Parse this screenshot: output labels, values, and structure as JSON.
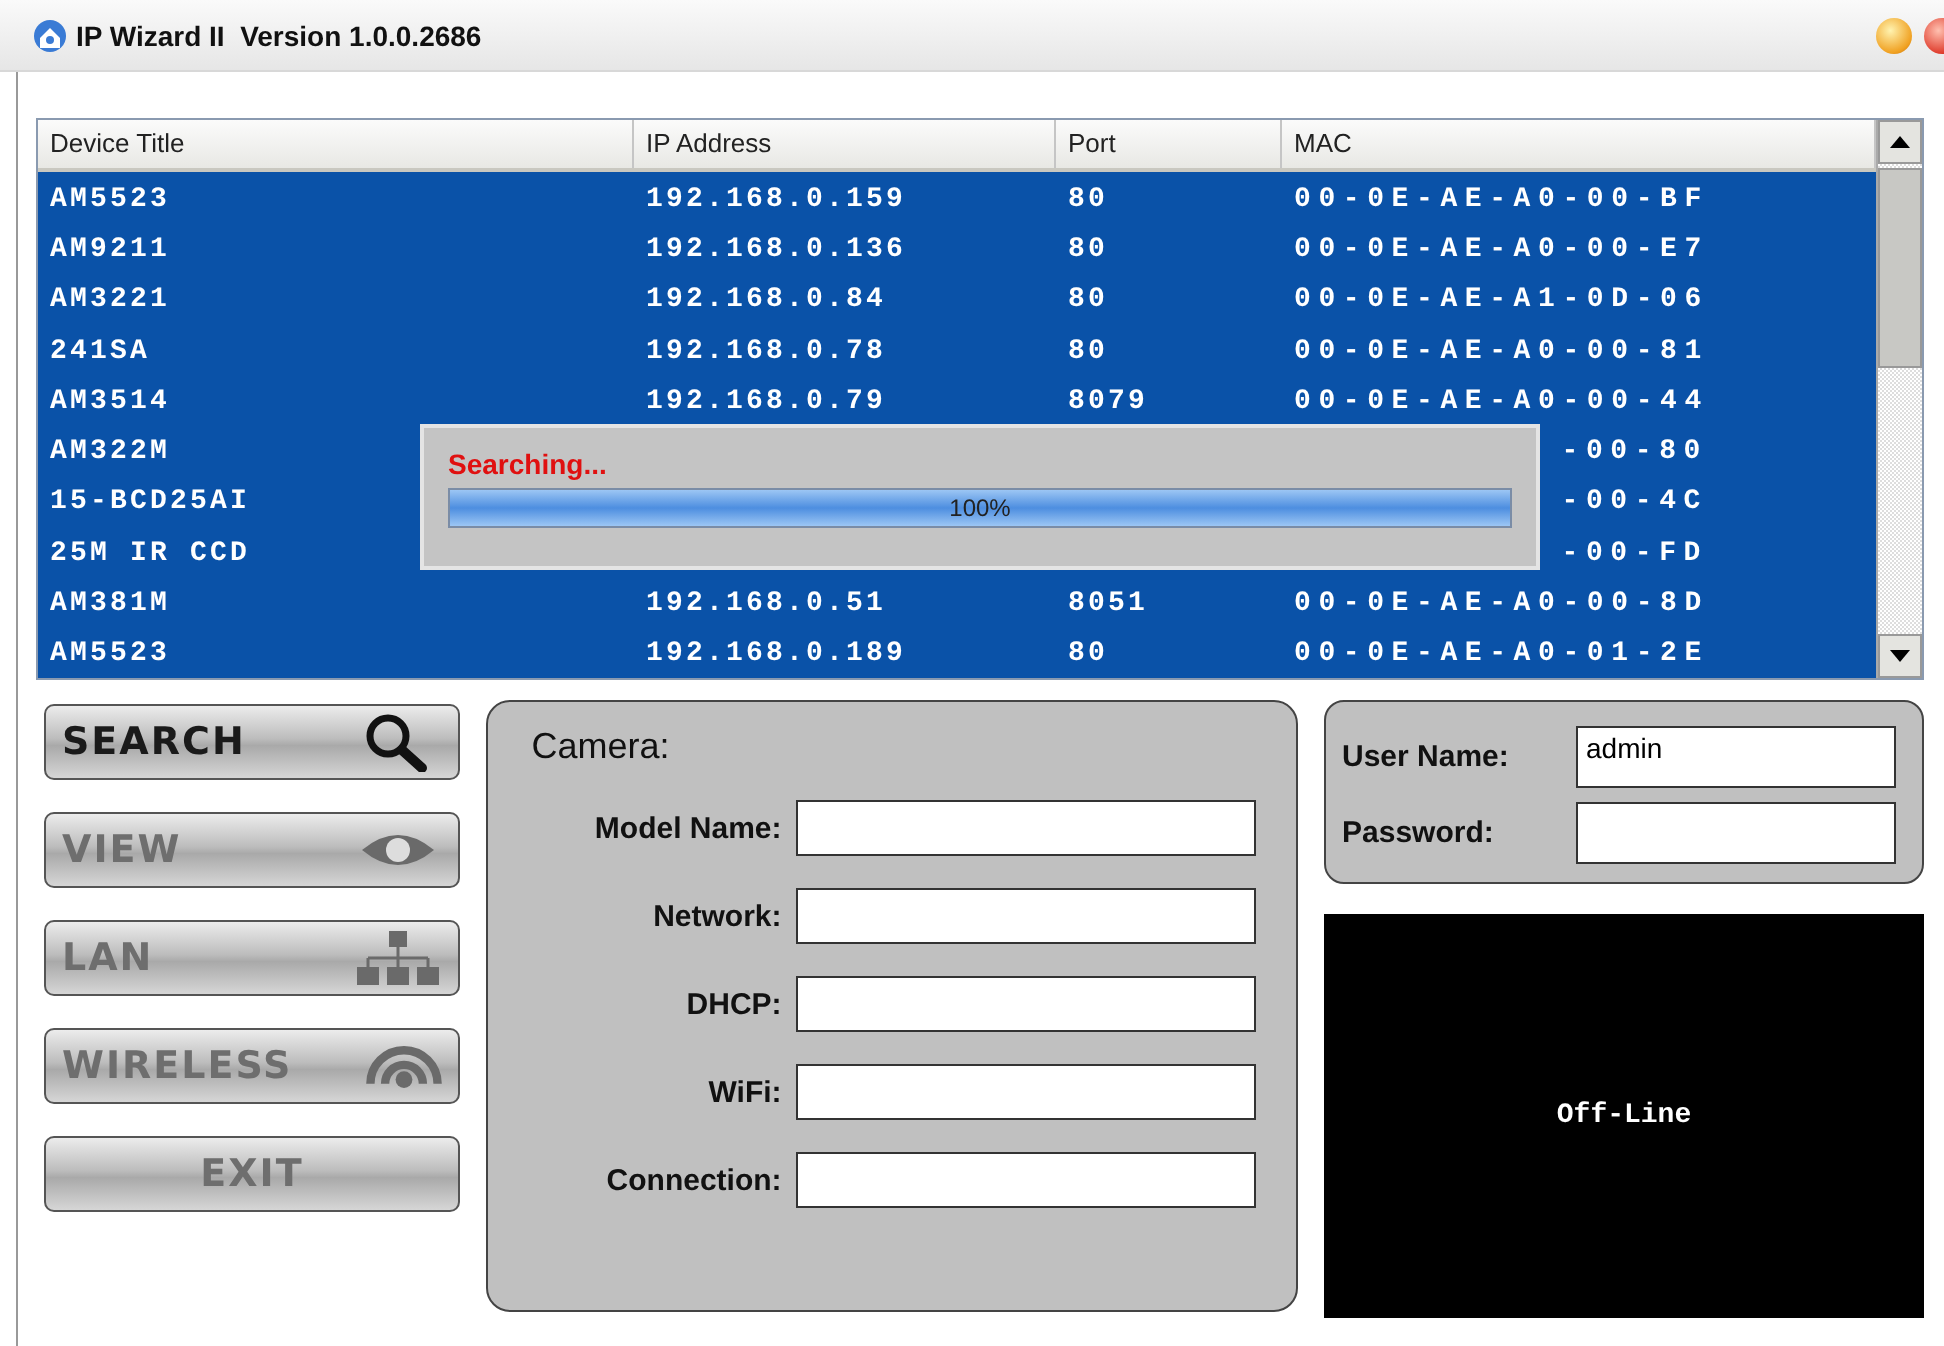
{
  "window": {
    "title": "IP Wizard II  Version 1.0.0.2686"
  },
  "table": {
    "columns": [
      "Device Title",
      "IP Address",
      "Port",
      "MAC"
    ],
    "rows": [
      {
        "title": "AM5523",
        "ip": "192.168.0.159",
        "port": "80",
        "mac": "00-0E-AE-A0-00-BF",
        "selected": true
      },
      {
        "title": "AM9211",
        "ip": "192.168.0.136",
        "port": "80",
        "mac": "00-0E-AE-A0-00-E7",
        "selected": true
      },
      {
        "title": "AM3221",
        "ip": "192.168.0.84",
        "port": "80",
        "mac": "00-0E-AE-A1-0D-06",
        "selected": true
      },
      {
        "title": "241SA",
        "ip": "192.168.0.78",
        "port": "80",
        "mac": "00-0E-AE-A0-00-81",
        "selected": true
      },
      {
        "title": "AM3514",
        "ip": "192.168.0.79",
        "port": "8079",
        "mac": "00-0E-AE-A0-00-44",
        "selected": true
      },
      {
        "title": "AM322M",
        "mac": "-00-80",
        "selected": true
      },
      {
        "title": "15-BCD25AI",
        "mac": "-00-4C",
        "selected": true
      },
      {
        "title": "25M IR CCD",
        "mac": "-00-FD",
        "selected": true
      },
      {
        "title": "AM381M",
        "ip": "192.168.0.51",
        "port": "8051",
        "mac": "00-0E-AE-A0-00-8D",
        "selected": true
      },
      {
        "title": "AM5523",
        "ip": "192.168.0.189",
        "port": "80",
        "mac": "00-0E-AE-A0-01-2E",
        "selected": true
      }
    ]
  },
  "dialog": {
    "label": "Searching...",
    "level": 1,
    "percent": "100%"
  },
  "buttons": [
    {
      "label": "SEARCH",
      "kind": "search",
      "disabled": false
    },
    {
      "label": "VIEW",
      "kind": "view",
      "disabled": true
    },
    {
      "label": "LAN",
      "kind": "lan",
      "disabled": true
    },
    {
      "label": "WIRELESS",
      "kind": "wireless",
      "disabled": true
    },
    {
      "label": "EXIT",
      "kind": "exit",
      "disabled": true
    }
  ],
  "camera": {
    "title": "Camera:",
    "fields": [
      {
        "label": "Model Name:"
      },
      {
        "label": "Network:"
      },
      {
        "label": "DHCP:"
      },
      {
        "label": "WiFi:"
      },
      {
        "label": "Connection:"
      }
    ]
  },
  "login": {
    "fields": [
      {
        "label": "User Name:",
        "value": "admin"
      },
      {
        "label": "Password:"
      }
    ]
  },
  "preview": {
    "status": "Off-Line"
  }
}
